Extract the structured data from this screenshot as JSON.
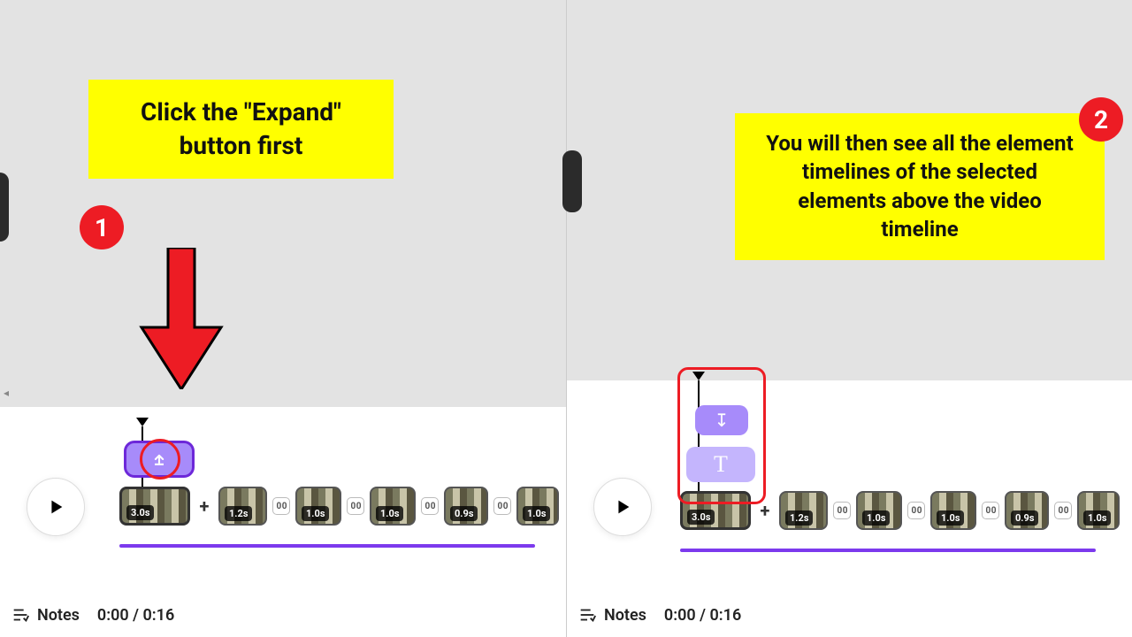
{
  "panels": [
    {
      "step": "1",
      "callout": "Click the \"Expand\" button first",
      "notes_label": "Notes",
      "time": "0:00 / 0:16",
      "clips": [
        "3.0s",
        "1.2s",
        "1.0s",
        "1.0s",
        "0.9s",
        "1.0s"
      ]
    },
    {
      "step": "2",
      "callout": "You will then see all the element timelines of the selected elements above the video timeline",
      "notes_label": "Notes",
      "time": "0:00 / 0:16",
      "element_icon": "↧",
      "text_icon": "T",
      "clips": [
        "3.0s",
        "1.2s",
        "1.0s",
        "1.0s",
        "0.9s",
        "1.0s"
      ]
    }
  ]
}
